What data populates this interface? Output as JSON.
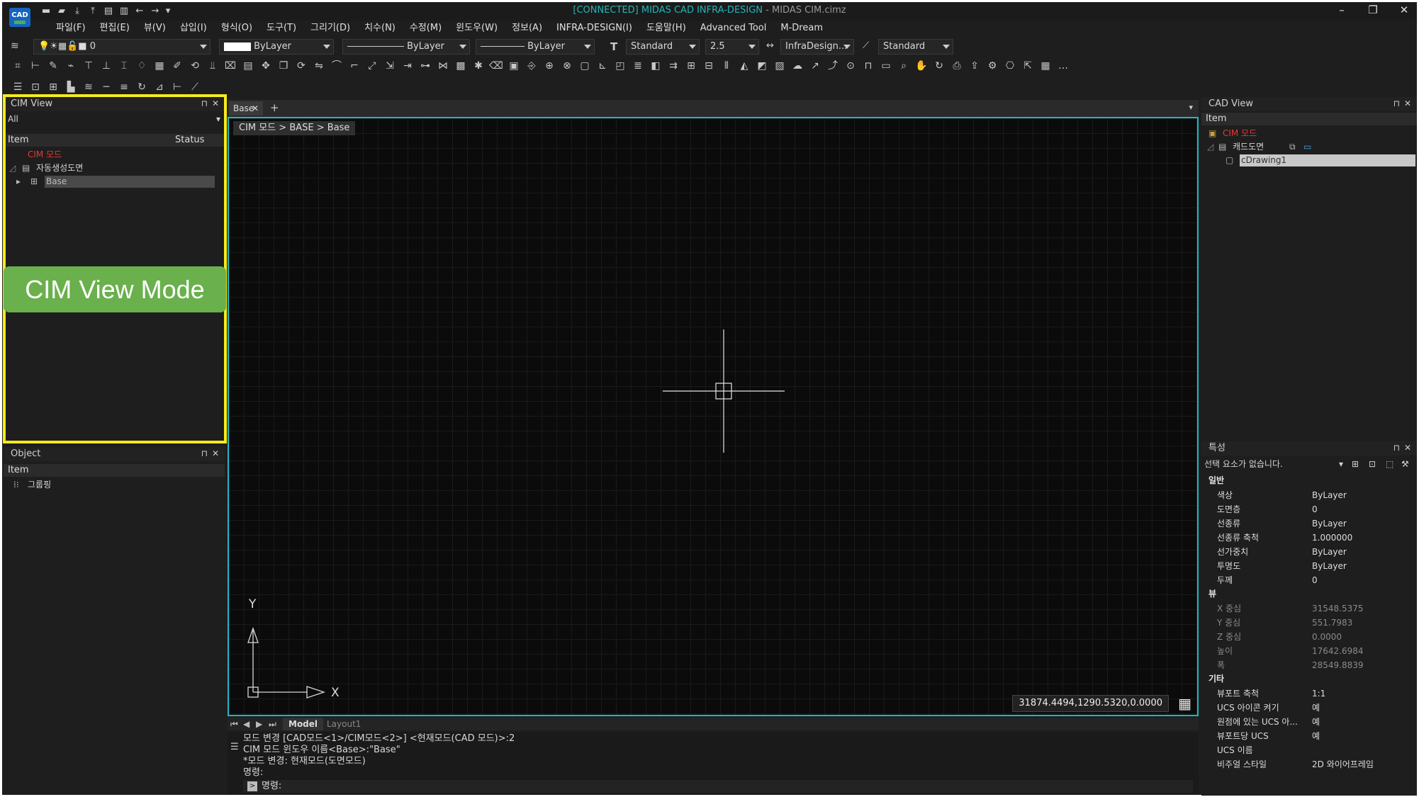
{
  "app": {
    "logo": "CAD",
    "title_connected": "[CONNECTED] MIDAS CAD INFRA-DESIGN",
    "title_rest": " - MIDAS CIM.cimz"
  },
  "menu": [
    "파일(F)",
    "편집(E)",
    "뷰(V)",
    "삽입(I)",
    "형식(O)",
    "도구(T)",
    "그리기(D)",
    "치수(N)",
    "수정(M)",
    "윈도우(W)",
    "정보(A)",
    "INFRA-DESIGN(I)",
    "도움말(H)",
    "Advanced Tool",
    "M-Dream"
  ],
  "props_toolbar": {
    "layer": "0",
    "color": "ByLayer",
    "linetype": "ByLayer",
    "lineweight": "ByLayer",
    "text_style": "Standard",
    "text_height": "2.5",
    "dim_style": "InfraDesign...",
    "table_style": "Standard"
  },
  "cim_view": {
    "title": "CIM View",
    "filter": "All",
    "col_item": "Item",
    "col_status": "Status",
    "root": "CIM 모드",
    "group": "자동생성도면",
    "selected": "Base"
  },
  "annotation": {
    "badge": "CIM View Mode",
    "highlight_color": "#f5ea1c",
    "badge_color": "#6ab04c"
  },
  "object_panel": {
    "title": "Object",
    "col_item": "Item",
    "node": "그룹핑"
  },
  "doc_tab": {
    "label": "Base",
    "add": "+"
  },
  "breadcrumb": "CIM 모드 > BASE > Base",
  "ucs": {
    "y": "Y",
    "x": "X"
  },
  "status": {
    "coords": "31874.4494,1290.5320,0.0000"
  },
  "layout_tabs": [
    "Model",
    "Layout1"
  ],
  "command": {
    "lines": [
      "모드 변경 [CAD모드<1>/CIM모드<2>] <현재모드(CAD 모드)>:2",
      "CIM 모드 윈도우 이름<Base>:\"Base\"",
      "*모드 변경: 현재모드(도면모드)",
      "명령:"
    ],
    "prompt": "명령:"
  },
  "cad_view": {
    "title": "CAD View",
    "col_item": "Item",
    "root": "CIM 모드",
    "group": "캐드도면",
    "selected": "cDrawing1"
  },
  "properties": {
    "title": "특성",
    "selection": "선택 요소가 없습니다.",
    "sections": {
      "general": "일반",
      "view": "뷰",
      "misc": "기타"
    },
    "general": [
      {
        "k": "색상",
        "v": "ByLayer"
      },
      {
        "k": "도면층",
        "v": "0"
      },
      {
        "k": "선종류",
        "v": "ByLayer"
      },
      {
        "k": "선종류 축척",
        "v": "1.000000"
      },
      {
        "k": "선가중치",
        "v": "ByLayer"
      },
      {
        "k": "투명도",
        "v": "ByLayer"
      },
      {
        "k": "두께",
        "v": "0"
      }
    ],
    "view": [
      {
        "k": "X 중심",
        "v": "31548.5375"
      },
      {
        "k": "Y 중심",
        "v": "551.7983"
      },
      {
        "k": "Z 중심",
        "v": "0.0000"
      },
      {
        "k": "높이",
        "v": "17642.6984"
      },
      {
        "k": "폭",
        "v": "28549.8839"
      }
    ],
    "misc": [
      {
        "k": "뷰포트 축척",
        "v": "1:1"
      },
      {
        "k": "UCS 아이콘 켜기",
        "v": "예"
      },
      {
        "k": "원점에 있는 UCS 아...",
        "v": "예"
      },
      {
        "k": "뷰포트당 UCS",
        "v": "예"
      },
      {
        "k": "UCS 이름",
        "v": ""
      },
      {
        "k": "비주얼 스타일",
        "v": "2D 와이어프레임"
      }
    ]
  }
}
